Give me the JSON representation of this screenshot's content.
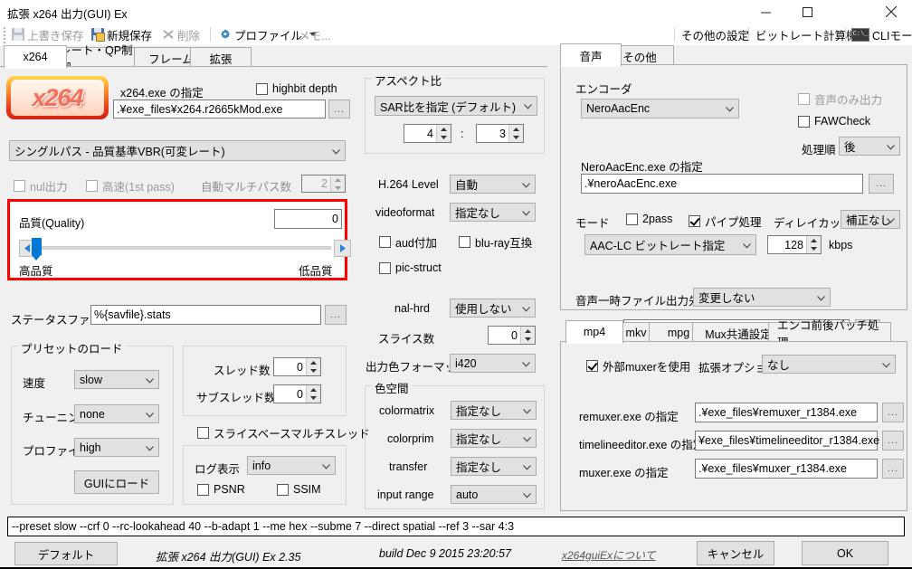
{
  "window": {
    "title": "拡張 x264 出力(GUI) Ex",
    "minimize": "—",
    "maximize": "▢",
    "close": "✕"
  },
  "toolbar": {
    "overwrite_save": "上書き保存",
    "new_save": "新規保存",
    "delete": "削除",
    "profile": "プロファイル",
    "memo": "メモ...",
    "other_settings": "その他の設定",
    "bitrate_calculator": "ビットレート計算機",
    "cli_mode": "CLIモード"
  },
  "tabs": [
    {
      "label": "x264",
      "active": true
    },
    {
      "label": "レート・QP制御",
      "active": false
    },
    {
      "label": "フレーム",
      "active": false
    },
    {
      "label": "拡張",
      "active": false
    }
  ],
  "x264_tab": {
    "logo_text": "x264",
    "exe_label": "x264.exe の指定",
    "exe_value": ".¥exe_files¥x264.r2665kMod.exe",
    "highbit_depth": "highbit depth",
    "highbit_checked": false,
    "browse": "...",
    "mode_value": "シングルパス - 品質基準VBR(可変レート)",
    "nul_output": "nul出力",
    "fast_1st_pass": "高速(1st pass)",
    "auto_multipass_label": "自動マルチパス数",
    "auto_multipass_value": "2",
    "quality": {
      "label": "品質(Quality)",
      "value": "0",
      "high_quality": "高品質",
      "low_quality": "低品質"
    },
    "status_file_label": "ステータスファイル",
    "status_file_value": "%{savfile}.stats",
    "preset_group": {
      "title": "プリセットのロード",
      "speed_label": "速度",
      "speed_value": "slow",
      "tuning_label": "チューニング",
      "tuning_value": "none",
      "profile_label": "プロファイル",
      "profile_value": "high",
      "load_button": "GUIにロード"
    },
    "thread_group": {
      "threads_label": "スレッド数",
      "threads_value": "0",
      "sub_threads_label": "サブスレッド数",
      "sub_threads_value": "0",
      "slicebase_mt": "スライスベースマルチスレッド",
      "slicebase_checked": false
    },
    "log_group": {
      "log_label": "ログ表示",
      "log_value": "info",
      "psnr": "PSNR",
      "psnr_checked": false,
      "ssim": "SSIM",
      "ssim_checked": false
    },
    "aspect_group": {
      "title": "アスペクト比",
      "mode_value": "SAR比を指定 (デフォルト)",
      "num": "4",
      "sep": ":",
      "den": "3"
    },
    "h264_level_label": "H.264 Level",
    "h264_level_value": "自動",
    "videoformat_label": "videoformat",
    "videoformat_value": "指定なし",
    "aud": "aud付加",
    "aud_checked": false,
    "bluray": "blu-ray互換",
    "bluray_checked": false,
    "pic_struct": "pic-struct",
    "pic_struct_checked": false,
    "nal_hrd_label": "nal-hrd",
    "nal_hrd_value": "使用しない",
    "slice_count_label": "スライス数",
    "slice_count_value": "0",
    "out_color_label": "出力色フォーマット",
    "out_color_value": "i420",
    "colorspace_group": {
      "title": "色空間",
      "colormatrix_label": "colormatrix",
      "colormatrix_value": "指定なし",
      "colorprim_label": "colorprim",
      "colorprim_value": "指定なし",
      "transfer_label": "transfer",
      "transfer_value": "指定なし",
      "input_range_label": "input range",
      "input_range_value": "auto"
    }
  },
  "audio_panel": {
    "tabs": [
      {
        "label": "音声",
        "active": true
      },
      {
        "label": "その他",
        "active": false
      }
    ],
    "encoder_label": "エンコーダ",
    "encoder_value": "NeroAacEnc",
    "audio_only": "音声のみ出力",
    "audio_only_checked": false,
    "fawcheck": "FAWCheck",
    "fawcheck_checked": false,
    "order_label": "処理順",
    "order_value": "後",
    "exe_label": "NeroAacEnc.exe の指定",
    "exe_value": ".¥neroAacEnc.exe",
    "browse": "...",
    "mode_label": "モード",
    "twopass": "2pass",
    "twopass_checked": false,
    "pipe": "パイプ処理",
    "pipe_checked": true,
    "delaycut_label": "ディレイカット",
    "delaycut_value": "補正なし",
    "bitrate_mode_value": "AAC-LC ビットレート指定",
    "bitrate_value": "128",
    "bitrate_unit": "kbps",
    "temp_out_label": "音声一時ファイル出力先",
    "temp_out_value": "変更しない",
    "temp_path_value": ""
  },
  "mux_panel": {
    "tabs": [
      {
        "label": "mp4",
        "active": true
      },
      {
        "label": "mkv",
        "active": false
      },
      {
        "label": "mpg",
        "active": false
      },
      {
        "label": "Mux共通設定",
        "active": false
      },
      {
        "label": "エンコ前後バッチ処理",
        "active": false
      }
    ],
    "use_external_muxer": "外部muxerを使用",
    "use_external_muxer_checked": true,
    "ext_option_label": "拡張オプション",
    "ext_option_value": "なし",
    "rows": [
      {
        "label": "remuxer.exe の指定",
        "value": ".¥exe_files¥remuxer_r1384.exe",
        "browse": "..."
      },
      {
        "label": "timelineeditor.exe の指定",
        "value": "¥exe_files¥timelineeditor_r1384.exe",
        "browse": "..."
      },
      {
        "label": "muxer.exe の指定",
        "value": ".¥exe_files¥muxer_r1384.exe",
        "browse": "..."
      }
    ]
  },
  "bottom": {
    "commandline": "--preset slow --crf 0 --rc-lookahead 40 --b-adapt 1 --me hex --subme 7 --direct spatial --ref 3 --sar 4:3",
    "default_button": "デフォルト",
    "app_name": "拡張 x264 出力(GUI) Ex 2.35",
    "build": "build Dec  9 2015 23:20:57",
    "about_link": "x264guiExについて",
    "cancel_button": "キャンセル",
    "ok_button": "OK"
  },
  "colors": {
    "accent": "#0078d7",
    "highlight_box": "#ff0000",
    "window_bg": "#f0f0f0"
  }
}
